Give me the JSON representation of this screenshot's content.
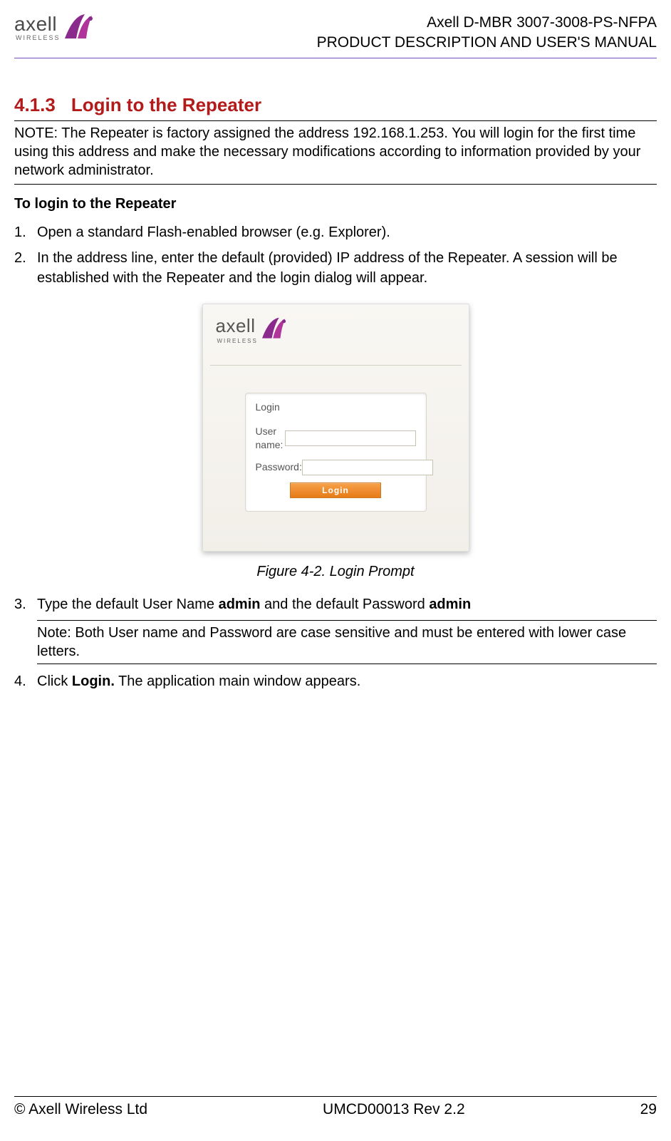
{
  "header": {
    "logo_text": "axell",
    "logo_subtext": "WIRELESS",
    "doc_line1": "Axell D-MBR 3007-3008-PS-NFPA",
    "doc_line2": "PRODUCT DESCRIPTION AND USER'S MANUAL"
  },
  "section": {
    "number": "4.1.3",
    "title": "Login to the Repeater"
  },
  "note_top": "NOTE: The Repeater is factory assigned the address 192.168.1.253. You will login for the first time using this address and make the necessary modifications according to information provided by your network administrator.",
  "subheading": "To login to the Repeater",
  "steps": {
    "s1_num": "1.",
    "s1": "Open a standard Flash-enabled browser (e.g. Explorer).",
    "s2_num": "2.",
    "s2": "In the address line, enter the default (provided) IP address of the Repeater. A session will be established with the Repeater and the login dialog will appear.",
    "s3_num": "3.",
    "s3_pre": "Type the default User Name ",
    "s3_b1": "admin",
    "s3_mid": " and the default Password ",
    "s3_b2": "admin",
    "s4_num": "4.",
    "s4_pre": "Click ",
    "s4_b": "Login.",
    "s4_post": " The application main window appears."
  },
  "login_panel": {
    "logo_text": "axell",
    "logo_subtext": "WIRELESS",
    "box_title": "Login",
    "username_label": "User name:",
    "password_label": "Password:",
    "button_label": "Login"
  },
  "figure_caption": "Figure 4-2. Login Prompt",
  "inline_note": "Note: Both User name and Password are case sensitive and must be entered with lower case letters.",
  "footer": {
    "left": "© Axell Wireless Ltd",
    "center": "UMCD00013 Rev 2.2",
    "right": "29"
  }
}
